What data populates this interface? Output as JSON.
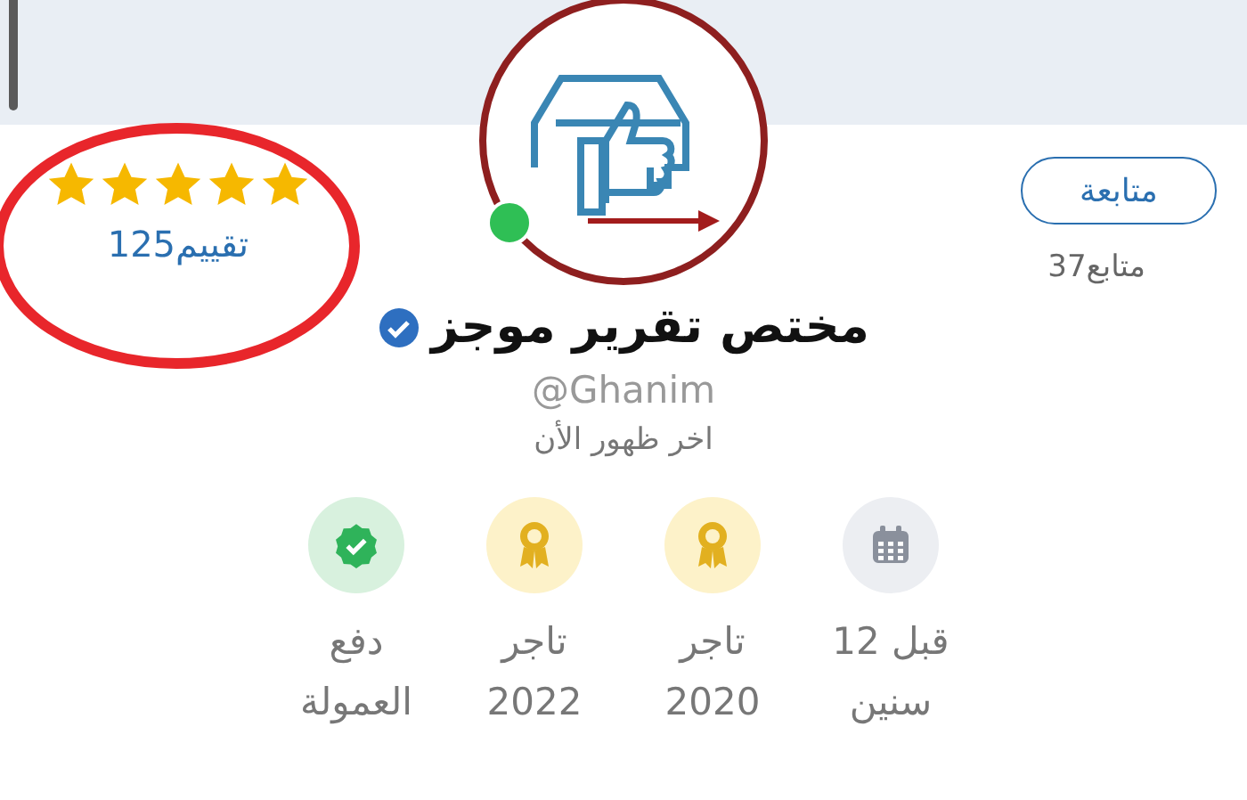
{
  "profile": {
    "rating": {
      "stars": 5,
      "text": "125تقييم"
    },
    "follow_button": "متابعة",
    "followers": "37متابع",
    "online": true,
    "name": "مختص تقرير موجز",
    "verified": true,
    "handle": "@Ghanim",
    "last_seen": "اخر ظهور الأن",
    "badges": [
      {
        "kind": "age",
        "lines": [
          "قبل 12",
          "سنين"
        ]
      },
      {
        "kind": "trader",
        "lines": [
          "تاجر",
          "2020"
        ]
      },
      {
        "kind": "trader",
        "lines": [
          "تاجر",
          "2022"
        ]
      },
      {
        "kind": "payment",
        "lines": [
          "دفع",
          "العمولة"
        ]
      }
    ]
  }
}
